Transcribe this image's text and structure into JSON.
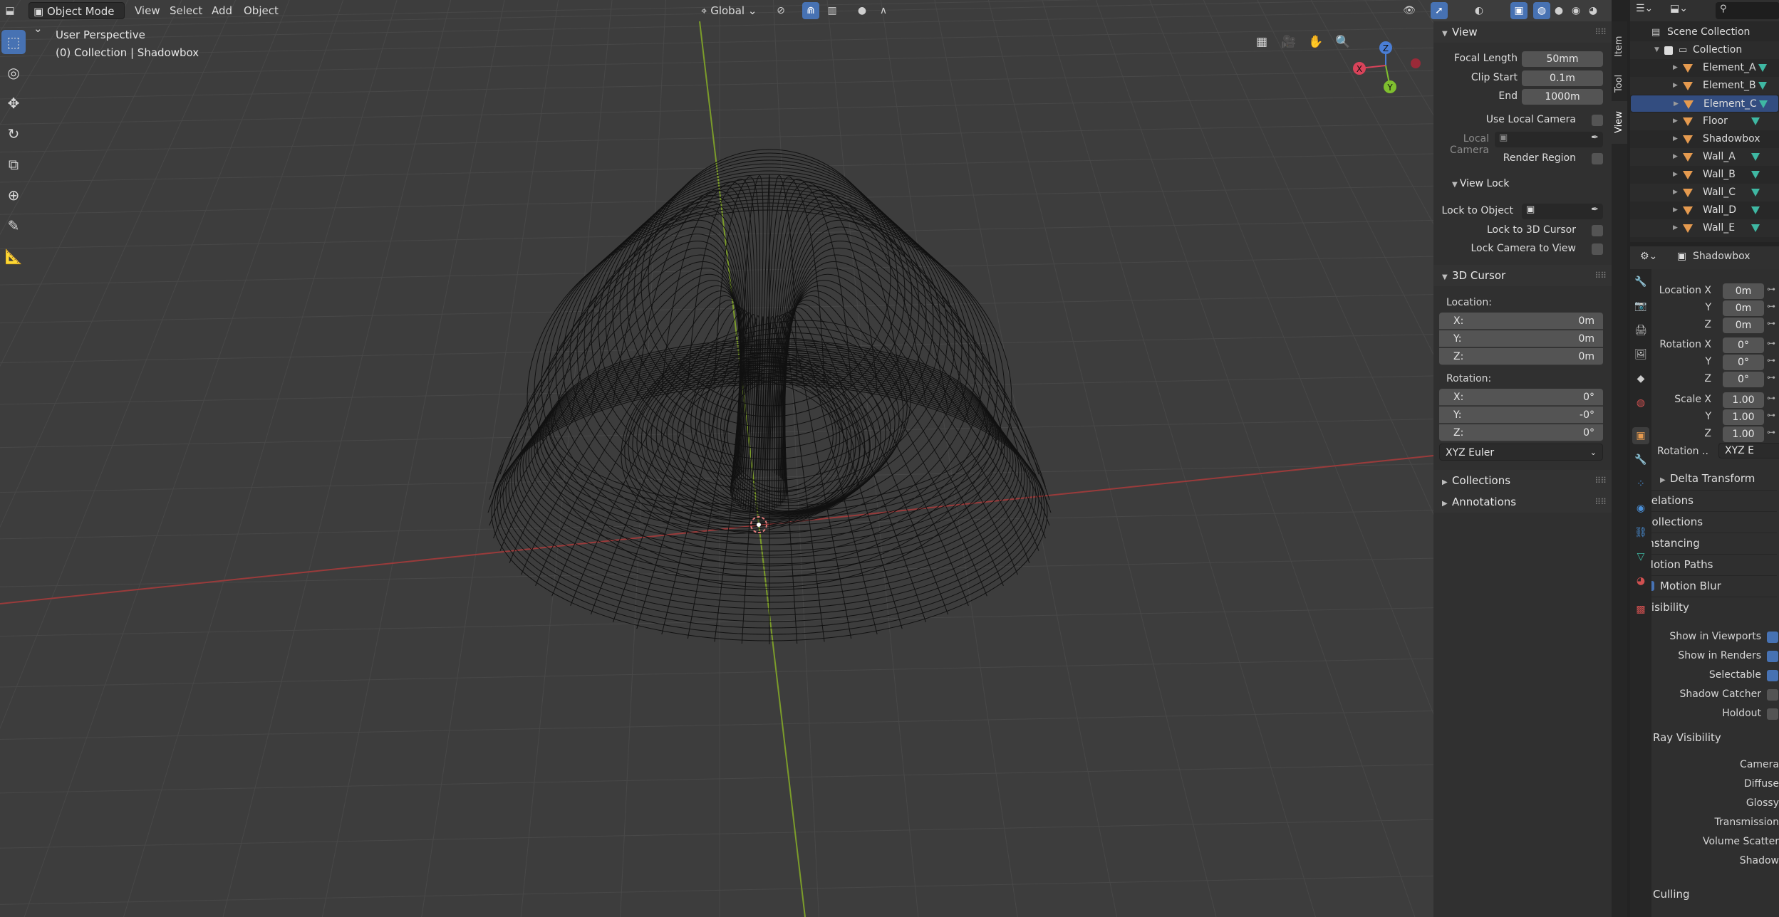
{
  "header": {
    "mode": "Object Mode",
    "menus": [
      "View",
      "Select",
      "Add",
      "Object"
    ],
    "transform_orientation": "Global"
  },
  "overlay": {
    "perspective": "User Perspective",
    "collection": "(0) Collection | Shadowbox"
  },
  "gizmo": {
    "x": "X",
    "y": "Y",
    "z": "Z"
  },
  "sidebar": {
    "tabs": [
      "Item",
      "Tool",
      "View"
    ],
    "active_tab": "View",
    "view": {
      "title": "View",
      "focal_length_label": "Focal Length",
      "focal_length": "50mm",
      "clip_start_label": "Clip Start",
      "clip_start": "0.1m",
      "end_label": "End",
      "end": "1000m",
      "use_local_camera": "Use Local Camera",
      "local_camera": "Local Camera",
      "render_region": "Render Region"
    },
    "view_lock": {
      "title": "View Lock",
      "lock_to_object": "Lock to Object",
      "lock_to_3d_cursor": "Lock to 3D Cursor",
      "lock_camera_to_view": "Lock Camera to View"
    },
    "cursor": {
      "title": "3D Cursor",
      "location_label": "Location:",
      "location": [
        {
          "axis": "X:",
          "value": "0m"
        },
        {
          "axis": "Y:",
          "value": "0m"
        },
        {
          "axis": "Z:",
          "value": "0m"
        }
      ],
      "rotation_label": "Rotation:",
      "rotation": [
        {
          "axis": "X:",
          "value": "0°"
        },
        {
          "axis": "Y:",
          "value": "-0°"
        },
        {
          "axis": "Z:",
          "value": "0°"
        }
      ],
      "rotation_mode": "XYZ Euler"
    },
    "collections": "Collections",
    "annotations": "Annotations"
  },
  "outliner": {
    "scene_collection": "Scene Collection",
    "collection": "Collection",
    "items": [
      "Element_A",
      "Element_B",
      "Element_C",
      "Floor",
      "Shadowbox",
      "Wall_A",
      "Wall_B",
      "Wall_C",
      "Wall_D",
      "Wall_E"
    ],
    "selected": "Element_C",
    "search_placeholder": ""
  },
  "properties": {
    "object_name": "Shadowbox",
    "location": [
      {
        "label": "Location X",
        "value": "0m"
      },
      {
        "label": "Y",
        "value": "0m"
      },
      {
        "label": "Z",
        "value": "0m"
      }
    ],
    "rotation": [
      {
        "label": "Rotation X",
        "value": "0°"
      },
      {
        "label": "Y",
        "value": "0°"
      },
      {
        "label": "Z",
        "value": "0°"
      }
    ],
    "scale": [
      {
        "label": "Scale X",
        "value": "1.00"
      },
      {
        "label": "Y",
        "value": "1.00"
      },
      {
        "label": "Z",
        "value": "1.00"
      }
    ],
    "rotation_mode_label": "Rotation ..",
    "rotation_mode": "XYZ E",
    "delta_transform": "Delta Transform",
    "sections": [
      "Relations",
      "Collections",
      "Instancing",
      "Motion Paths",
      "Motion Blur",
      "Visibility"
    ],
    "visibility": [
      {
        "label": "Show in Viewports",
        "checked": true
      },
      {
        "label": "Show in Renders",
        "checked": true
      },
      {
        "label": "Selectable",
        "checked": true
      },
      {
        "label": "Shadow Catcher",
        "checked": false
      },
      {
        "label": "Holdout",
        "checked": false
      }
    ],
    "ray_visibility": "Ray Visibility",
    "rays": [
      "Camera",
      "Diffuse",
      "Glossy",
      "Transmission",
      "Volume Scatter",
      "Shadow"
    ],
    "culling": "Culling"
  },
  "colors": {
    "accent": "#4772b3",
    "x_axis": "#c0504d",
    "y_axis": "#8bb33b",
    "object": "#e59a4f",
    "mesh": "#3fb8a3"
  }
}
